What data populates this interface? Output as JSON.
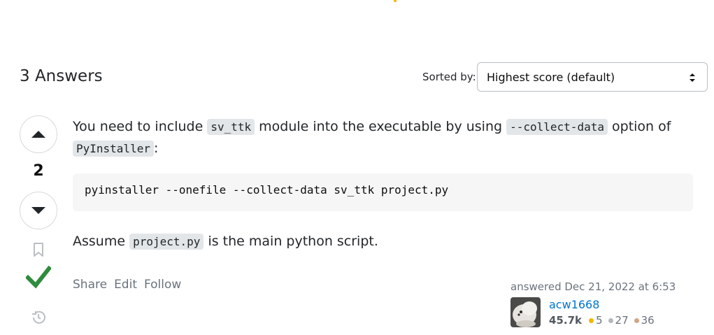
{
  "header": {
    "answers_count_label": "3 Answers",
    "sort_label": "Sorted by:",
    "sort_selected": "Highest score (default)"
  },
  "answer": {
    "vote_count": "2",
    "accepted": true,
    "paragraph1": {
      "t1": "You need to include ",
      "c1": "sv_ttk",
      "t2": " module into the executable by using ",
      "c2": "--collect-data",
      "t3": " option of ",
      "c3": "PyInstaller",
      "t4": ":"
    },
    "code_block": "pyinstaller --onefile --collect-data sv_ttk project.py",
    "paragraph2": {
      "t1": "Assume ",
      "c1": "project.py",
      "t2": " is the main python script."
    },
    "menu": {
      "share": "Share",
      "edit": "Edit",
      "follow": "Follow"
    },
    "signature": {
      "action": "answered Dec 21, 2022 at 6:53",
      "user_name": "acw1668",
      "reputation": "45.7k",
      "gold": "5",
      "silver": "27",
      "bronze": "36"
    }
  },
  "icons": {
    "upvote": "arrow-up-icon",
    "downvote": "arrow-down-icon",
    "bookmark": "bookmark-icon",
    "accepted": "checkmark-icon",
    "history": "history-icon",
    "sort_caret": "updown-caret-icon"
  },
  "colors": {
    "accepted_green": "#2f8b3d",
    "link_blue": "#0074cc",
    "gold": "#f1b600",
    "silver": "#9a9ea2",
    "bronze": "#ab825f"
  }
}
